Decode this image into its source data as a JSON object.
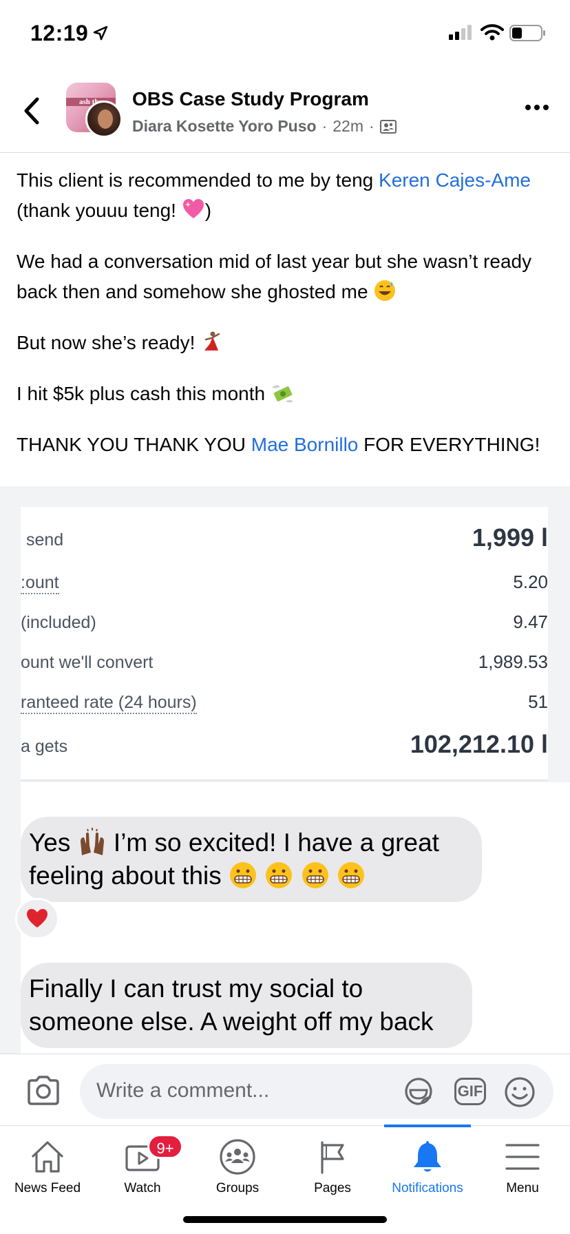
{
  "status_bar": {
    "time": "12:19"
  },
  "post_header": {
    "group_name": "OBS Case Study Program",
    "author": "Diara Kosette Yoro Puso",
    "separator": "·",
    "time_ago": "22m",
    "thumb_text": "ash tho"
  },
  "post_body": {
    "p1_text": "This client is recommended to me by teng ",
    "p1_mention": "Keren Cajes-Ame",
    "p1_tail": "(thank youuu teng! ",
    "p1_close": ")",
    "p2_text": "We had a conversation mid of last year but she wasn’t ready back then and somehow she ghosted me ",
    "p3_text": "But now she’s ready! ",
    "p4_text": "I hit $5k plus cash this month ",
    "p5_text_a": "THANK YOU THANK YOU ",
    "p5_mention": "Mae Bornillo",
    "p5_text_b": " FOR EVERYTHING!"
  },
  "screenshot": {
    "rows": [
      {
        "label": "send",
        "value": "1,999 l"
      },
      {
        "label": ":ount",
        "value": "5.20"
      },
      {
        "label": "(included)",
        "value": "9.47"
      },
      {
        "label": "ount we'll convert",
        "value": "1,989.53"
      },
      {
        "label": "ranteed rate (24 hours)",
        "value": "51"
      },
      {
        "label": "a gets",
        "value": "102,212.10 l"
      }
    ],
    "message_1_a": "Yes ",
    "message_1_b": " I’m so excited! I have a great",
    "message_1_c": "feeling about this ",
    "message_2_a": "Finally I can trust my social to",
    "message_2_b": "someone else. A weight off my back"
  },
  "comment_bar": {
    "placeholder": "Write a comment...",
    "gif_label": "GIF"
  },
  "tabs": [
    {
      "label": "News Feed"
    },
    {
      "label": "Watch",
      "badge": "9+"
    },
    {
      "label": "Groups"
    },
    {
      "label": "Pages"
    },
    {
      "label": "Notifications"
    },
    {
      "label": "Menu"
    }
  ],
  "colors": {
    "link": "#216fdb",
    "accent": "#1877f2",
    "badge": "#e41e3f"
  },
  "icons": {
    "back": "chevron-left-icon",
    "more": "more-dots-icon",
    "privacy": "group-members-icon",
    "camera": "camera-icon",
    "sticker": "sticker-icon",
    "gif": "gif-icon",
    "emoji": "smiley-icon"
  }
}
